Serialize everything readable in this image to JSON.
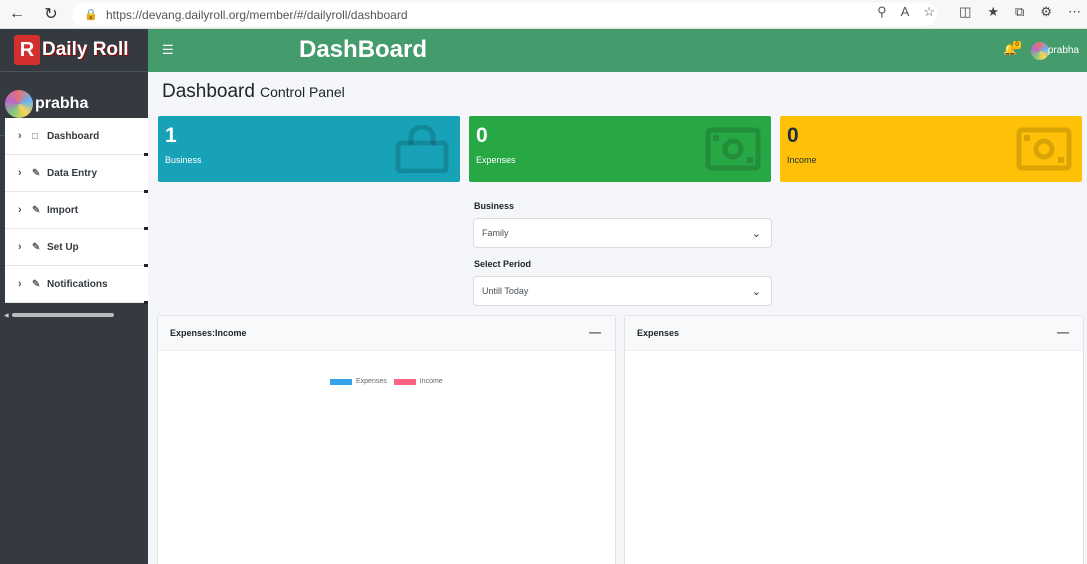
{
  "browser": {
    "url": "https://devang.dailyroll.org/member/#/dailyroll/dashboard"
  },
  "brand": {
    "logo_letter": "R",
    "name": "Daily Roll"
  },
  "sidebar": {
    "user_name": "prabha",
    "items": [
      {
        "label": "Dashboard",
        "icon": "file-icon"
      },
      {
        "label": "Data Entry",
        "icon": "pencil-icon"
      },
      {
        "label": "Import",
        "icon": "pencil-icon"
      },
      {
        "label": "Set Up",
        "icon": "pencil-icon"
      },
      {
        "label": "Notifications",
        "icon": "pencil-icon"
      }
    ]
  },
  "header": {
    "title": "DashBoard",
    "notification_count": "0",
    "user_name": "prabha"
  },
  "page": {
    "title": "Dashboard",
    "subtitle": "Control Panel"
  },
  "stats": [
    {
      "value": "1",
      "label": "Business",
      "color": "#17a2b8",
      "icon": "shopping-bag-icon"
    },
    {
      "value": "0",
      "label": "Expenses",
      "color": "#28a745",
      "icon": "money-icon"
    },
    {
      "value": "0",
      "label": "Income",
      "color": "#ffc107",
      "icon": "money-icon"
    }
  ],
  "filters": {
    "business_label": "Business",
    "business_value": "Family",
    "period_label": "Select Period",
    "period_value": "Untill Today"
  },
  "cards": {
    "left_title": "Expenses:Income",
    "right_title": "Expenses"
  },
  "chart_data": {
    "type": "bar",
    "series": [
      {
        "name": "Expenses",
        "color": "#36a2eb",
        "values": []
      },
      {
        "name": "Income",
        "color": "#ff6384",
        "values": []
      }
    ]
  }
}
